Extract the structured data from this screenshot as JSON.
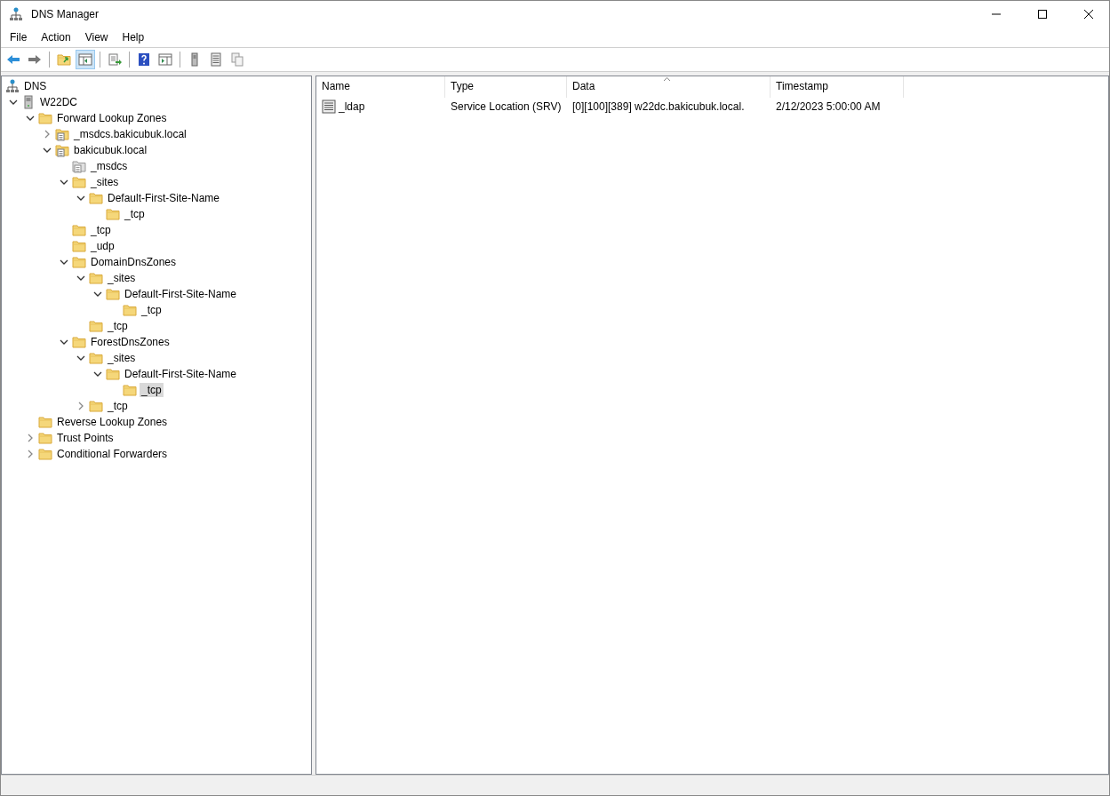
{
  "window": {
    "title": "DNS Manager"
  },
  "menu": [
    "File",
    "Action",
    "View",
    "Help"
  ],
  "toolbar": [
    {
      "kind": "back",
      "pressed": false
    },
    {
      "kind": "forward",
      "pressed": false
    },
    {
      "kind": "sep"
    },
    {
      "kind": "up",
      "pressed": false
    },
    {
      "kind": "tree",
      "pressed": true
    },
    {
      "kind": "sep"
    },
    {
      "kind": "export",
      "pressed": false
    },
    {
      "kind": "sep"
    },
    {
      "kind": "help",
      "pressed": false
    },
    {
      "kind": "pane",
      "pressed": false
    },
    {
      "kind": "sep"
    },
    {
      "kind": "server",
      "pressed": false
    },
    {
      "kind": "list",
      "pressed": false
    },
    {
      "kind": "copy",
      "pressed": false
    }
  ],
  "tree": [
    {
      "label": "DNS",
      "kind": "dns",
      "selected": false,
      "children": [
        {
          "label": "W22DC",
          "kind": "server",
          "expanded": true,
          "selected": false,
          "children": [
            {
              "label": "Forward Lookup Zones",
              "kind": "folder",
              "expanded": true,
              "selected": false,
              "children": [
                {
                  "label": "_msdcs.bakicubuk.local",
                  "kind": "zone",
                  "expanded": false,
                  "selected": false
                },
                {
                  "label": "bakicubuk.local",
                  "kind": "zone",
                  "expanded": true,
                  "selected": false,
                  "children": [
                    {
                      "label": "_msdcs",
                      "kind": "delegation",
                      "selected": false
                    },
                    {
                      "label": "_sites",
                      "kind": "folder",
                      "expanded": true,
                      "selected": false,
                      "children": [
                        {
                          "label": "Default-First-Site-Name",
                          "kind": "folder",
                          "expanded": true,
                          "selected": false,
                          "children": [
                            {
                              "label": "_tcp",
                              "kind": "folder",
                              "selected": false
                            }
                          ]
                        }
                      ]
                    },
                    {
                      "label": "_tcp",
                      "kind": "folder",
                      "selected": false
                    },
                    {
                      "label": "_udp",
                      "kind": "folder",
                      "selected": false
                    },
                    {
                      "label": "DomainDnsZones",
                      "kind": "folder",
                      "expanded": true,
                      "selected": false,
                      "children": [
                        {
                          "label": "_sites",
                          "kind": "folder",
                          "expanded": true,
                          "selected": false,
                          "children": [
                            {
                              "label": "Default-First-Site-Name",
                              "kind": "folder",
                              "expanded": true,
                              "selected": false,
                              "children": [
                                {
                                  "label": "_tcp",
                                  "kind": "folder",
                                  "selected": false
                                }
                              ]
                            }
                          ]
                        },
                        {
                          "label": "_tcp",
                          "kind": "folder",
                          "selected": false
                        }
                      ]
                    },
                    {
                      "label": "ForestDnsZones",
                      "kind": "folder",
                      "expanded": true,
                      "selected": false,
                      "children": [
                        {
                          "label": "_sites",
                          "kind": "folder",
                          "expanded": true,
                          "selected": false,
                          "children": [
                            {
                              "label": "Default-First-Site-Name",
                              "kind": "folder",
                              "expanded": true,
                              "selected": false,
                              "children": [
                                {
                                  "label": "_tcp",
                                  "kind": "folder",
                                  "selected": true
                                }
                              ]
                            }
                          ]
                        },
                        {
                          "label": "_tcp",
                          "kind": "folder",
                          "expanded": false,
                          "selected": false
                        }
                      ]
                    }
                  ]
                }
              ]
            },
            {
              "label": "Reverse Lookup Zones",
              "kind": "folder",
              "selected": false
            },
            {
              "label": "Trust Points",
              "kind": "folder",
              "expanded": false,
              "selected": false
            },
            {
              "label": "Conditional Forwarders",
              "kind": "folder",
              "expanded": false,
              "selected": false
            }
          ]
        }
      ]
    }
  ],
  "list": {
    "columns": [
      {
        "label": "Name",
        "sorted": false
      },
      {
        "label": "Type",
        "sorted": false
      },
      {
        "label": "Data",
        "sorted": true
      },
      {
        "label": "Timestamp",
        "sorted": false
      }
    ],
    "rows": [
      {
        "cells": [
          "_ldap",
          "Service Location (SRV)",
          "[0][100][389] w22dc.bakicubuk.local.",
          "2/12/2023 5:00:00 AM"
        ]
      }
    ]
  }
}
